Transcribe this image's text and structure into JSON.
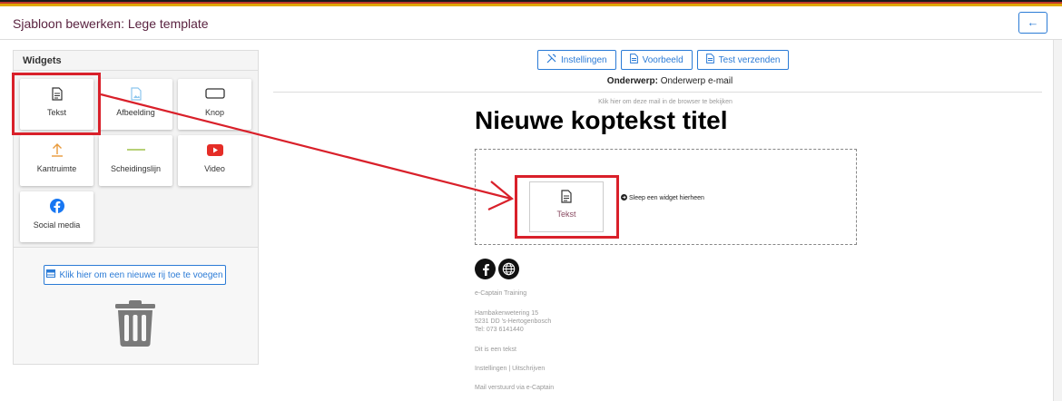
{
  "header": {
    "title": "Sjabloon bewerken: Lege template",
    "back_icon": "arrow-left-icon"
  },
  "widgets": {
    "title": "Widgets",
    "items": [
      {
        "label": "Tekst",
        "icon": "document-icon"
      },
      {
        "label": "Afbeelding",
        "icon": "image-icon"
      },
      {
        "label": "Knop",
        "icon": "button-icon"
      },
      {
        "label": "Kantruimte",
        "icon": "arrow-up-icon"
      },
      {
        "label": "Scheidingslijn",
        "icon": "divider-icon"
      },
      {
        "label": "Video",
        "icon": "youtube-icon"
      },
      {
        "label": "Social media",
        "icon": "facebook-icon"
      }
    ],
    "add_row_label": "Klik hier om een nieuwe rij toe te voegen",
    "trash_icon": "trash-icon"
  },
  "toolbar": {
    "settings_label": "Instellingen",
    "preview_label": "Voorbeeld",
    "test_label": "Test verzenden"
  },
  "subject": {
    "label": "Onderwerp:",
    "value": "Onderwerp e-mail"
  },
  "email": {
    "browser_link": "Klik hier om deze mail in de browser te bekijken",
    "title": "Nieuwe koptekst titel",
    "drag_widget_label": "Tekst",
    "drop_hint": "Sleep een widget hierheen",
    "footer": {
      "company": "e-Captain Training",
      "address_street": "Hambakenwetering 15",
      "address_city": "5231 DD 's-Hertogenbosch",
      "phone": "Tel: 073 6141440",
      "text": "Dit is een tekst",
      "links": "Instellingen | Uitschrijven",
      "sent_via": "Mail verstuurd via e-Captain"
    }
  },
  "colors": {
    "accent": "#2b7bd6",
    "title": "#5a2340",
    "highlight": "#d9202a"
  }
}
